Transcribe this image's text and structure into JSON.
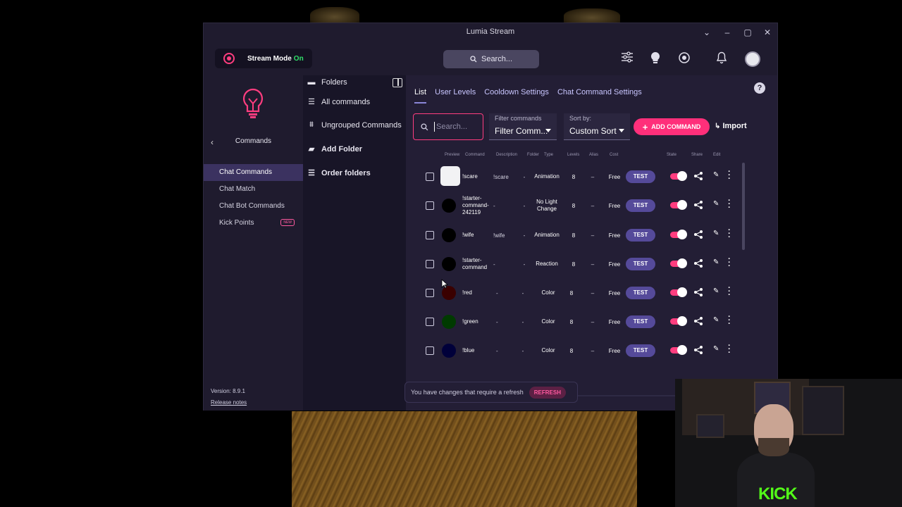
{
  "window": {
    "title": "Lumia Stream",
    "controls": {
      "dropdown": "⌄",
      "minimize": "–",
      "maximize": "▢",
      "close": "✕"
    }
  },
  "appbar": {
    "stream_mode_label": "Stream Mode",
    "stream_mode_state": "On",
    "search_label": "Search..."
  },
  "leftnav": {
    "section_title": "Commands",
    "back": "‹",
    "items": [
      {
        "label": "Chat Commands",
        "active": true
      },
      {
        "label": "Chat Match"
      },
      {
        "label": "Chat Bot Commands"
      },
      {
        "label": "Kick Points",
        "badge": "NEW"
      }
    ],
    "version": "Version: 8.9.1",
    "release_notes": "Release notes"
  },
  "folders": {
    "header": "Folders",
    "items": [
      {
        "label": "All commands"
      },
      {
        "label": "Ungrouped Commands"
      },
      {
        "label": "Add Folder"
      },
      {
        "label": "Order folders"
      }
    ]
  },
  "tabs": [
    "List",
    "User Levels",
    "Cooldown Settings",
    "Chat Command Settings"
  ],
  "help": "?",
  "toolbar": {
    "search_placeholder": "Search...",
    "filter_label": "Filter commands",
    "filter_value": "Filter Comm...",
    "sort_label": "Sort by:",
    "sort_value": "Custom Sort",
    "add_command": "ADD COMMAND",
    "import": "Import"
  },
  "columns": [
    "Preview",
    "Command",
    "Description",
    "Folder",
    "Type",
    "Levels",
    "Alias",
    "Cost",
    "State",
    "Share",
    "Edit"
  ],
  "rows": [
    {
      "preview": "white-square",
      "command": "!scare",
      "description": "!scare",
      "folder": "-",
      "type": "Animation",
      "levels": "8",
      "alias": "–",
      "cost": "Free",
      "test": "TEST"
    },
    {
      "preview": "#000000",
      "command": "!starter-command-242119",
      "description": "-",
      "folder": "-",
      "type": "No Light Change",
      "levels": "8",
      "alias": "–",
      "cost": "Free",
      "test": "TEST"
    },
    {
      "preview": "#000000",
      "command": "!wife",
      "description": "!wife",
      "folder": "-",
      "type": "Animation",
      "levels": "8",
      "alias": "–",
      "cost": "Free",
      "test": "TEST"
    },
    {
      "preview": "#000000",
      "command": "!starter-command",
      "description": "-",
      "folder": "-",
      "type": "Reaction",
      "levels": "8",
      "alias": "–",
      "cost": "Free",
      "test": "TEST"
    },
    {
      "preview": "#3a0000",
      "command": "!red",
      "description": "-",
      "folder": "-",
      "type": "Color",
      "levels": "8",
      "alias": "–",
      "cost": "Free",
      "test": "TEST"
    },
    {
      "preview": "#003a00",
      "command": "!green",
      "description": "-",
      "folder": "-",
      "type": "Color",
      "levels": "8",
      "alias": "–",
      "cost": "Free",
      "test": "TEST"
    },
    {
      "preview": "#00003a",
      "command": "!blue",
      "description": "-",
      "folder": "-",
      "type": "Color",
      "levels": "8",
      "alias": "–",
      "cost": "Free",
      "test": "TEST"
    }
  ],
  "refresh": {
    "message": "You have changes that require a refresh",
    "button": "REFRESH"
  },
  "webcam": {
    "overlay_text": "KICK"
  },
  "colors": {
    "accent": "#ff2f7a",
    "test_button": "#554a9a",
    "active_nav": "#3b3260",
    "kick_green": "#53fc18"
  }
}
